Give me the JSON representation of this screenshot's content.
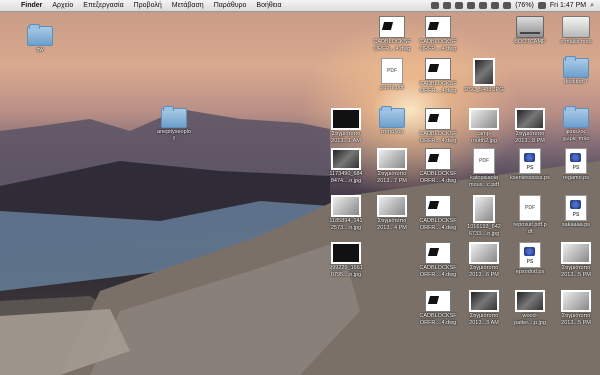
{
  "menubar": {
    "apple": "",
    "app_name": "Finder",
    "menus": [
      "Αρχείο",
      "Επεξεργασία",
      "Προβολή",
      "Μετάβαση",
      "Παράθυρο",
      "Βοήθεια"
    ],
    "battery": "(76%)",
    "clock": "Fri 1:47 PM",
    "search": "⌕"
  },
  "desktop_icons": [
    {
      "label": "qw",
      "type": "folder"
    },
    {
      "label": "anepityxeoplo\nf",
      "type": "folder"
    },
    {
      "label": "CADBLOCKSF\nORFR....4.dwg",
      "type": "dwg"
    },
    {
      "label": "CADBLOCKSF\nORFR....4.dwg",
      "type": "dwg"
    },
    {
      "label": "BOOTCAMP",
      "type": "hd"
    },
    {
      "label": "o makis mou",
      "type": "home"
    },
    {
      "label": "ρουπι.pdf",
      "type": "pdf"
    },
    {
      "label": "CADBLOCKSF\nORFR....4.dwg",
      "type": "dwg"
    },
    {
      "label": "DSC_5488.JPG",
      "type": "photo-tall"
    },
    {
      "label": "desktop 7",
      "type": "folder"
    },
    {
      "label": "Στιγμιότυπο\n2013...1 AM",
      "type": "photo-dark"
    },
    {
      "label": "στιπάλου",
      "type": "folder"
    },
    {
      "label": "CADBLOCKSF\nORFR....4.dwg",
      "type": "dwg"
    },
    {
      "label": "camp-\nroutth2.jpg",
      "type": "photo-light"
    },
    {
      "label": "Στιγμιότυπο\n2013...8 PM",
      "type": "photo"
    },
    {
      "label": "φάκελος\nχωρίς τίτλο",
      "type": "folder"
    },
    {
      "label": "1173490_684\n8474....n.jpg",
      "type": "photo"
    },
    {
      "label": "Στιγμιότυπο\n2013...7 PM",
      "type": "photo-light"
    },
    {
      "label": "CADBLOCKSF\nORFR....4.dwg",
      "type": "dwg"
    },
    {
      "label": "katopsiaola\nmous...c.pdf",
      "type": "pdf"
    },
    {
      "label": "kseniessssss.ps",
      "type": "ps"
    },
    {
      "label": "regamo.ps",
      "type": "ps"
    },
    {
      "label": "1185894_141\n2573....n.jpg",
      "type": "photo-light"
    },
    {
      "label": "Στιγμιότυπο\n2013...4 PM",
      "type": "photo-light"
    },
    {
      "label": "CADBLOCKSF\nORFR....4.dwg",
      "type": "dwg"
    },
    {
      "label": "1016193_642\n6733....n.jpg",
      "type": "photo-tall-light"
    },
    {
      "label": "reposuit.pdf.p\ndf",
      "type": "pdf"
    },
    {
      "label": "sakaaaa.ps",
      "type": "ps"
    },
    {
      "label": "999229_1661\n0795....n.jpg",
      "type": "photo-dark"
    },
    {
      "label": "CADBLOCKSF\nORFR....4.dwg",
      "type": "dwg"
    },
    {
      "label": "Στιγμιότυπο\n2013...6 PM",
      "type": "photo-light"
    },
    {
      "label": "epsodod.ps",
      "type": "ps"
    },
    {
      "label": "Στιγμιότυπο\n2013...5 PM",
      "type": "photo-light"
    },
    {
      "label": "CADBLOCKSF\nORFR....4.dwg",
      "type": "dwg"
    },
    {
      "label": "Στιγμιότυπο\n2013...3 AM",
      "type": "photo"
    },
    {
      "label": "wood-\npatter....p.jpg",
      "type": "photo"
    },
    {
      "label": "Στιγμιότυπο\n2013...5 PM",
      "type": "photo-light"
    }
  ]
}
